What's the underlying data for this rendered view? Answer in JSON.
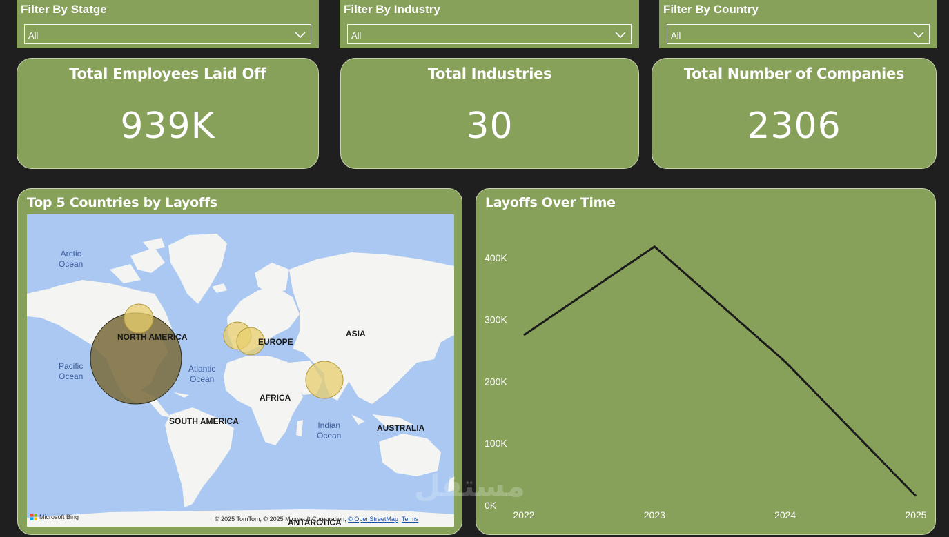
{
  "filters": [
    {
      "title": "Filter By Statge",
      "value": "All"
    },
    {
      "title": "Filter By Industry",
      "value": "All"
    },
    {
      "title": "Filter By Country",
      "value": "All"
    }
  ],
  "kpis": [
    {
      "title": "Total Employees Laid Off",
      "value": "939K"
    },
    {
      "title": "Total Industries",
      "value": "30"
    },
    {
      "title": "Total Number of Companies",
      "value": "2306"
    }
  ],
  "map": {
    "title": "Top 5 Countries by Layoffs",
    "labels": {
      "arctic": [
        "Arctic",
        "Ocean"
      ],
      "pacific": [
        "Pacific",
        "Ocean"
      ],
      "atlantic": [
        "Atlantic",
        "Ocean"
      ],
      "indian": [
        "Indian",
        "Ocean"
      ],
      "north_america": "NORTH AMERICA",
      "south_america": "SOUTH AMERICA",
      "europe": "EUROPE",
      "africa": "AFRICA",
      "asia": "ASIA",
      "australia": "AUSTRALIA",
      "antarctica": "ANTARCTICA"
    },
    "attribution": {
      "text": "© 2025 TomTom, © 2025 Microsoft Corporation, ",
      "osm": "© OpenStreetMap",
      "terms": "Terms"
    },
    "bing_label": "Microsoft Bing",
    "bubble_color": "#e8cf6c",
    "large_bubble_color": "#7a6a3a"
  },
  "chart_data": {
    "type": "line",
    "title": "Layoffs Over Time",
    "x": [
      "2022",
      "2023",
      "2024",
      "2025"
    ],
    "series": [
      {
        "values": [
          275000,
          418000,
          232000,
          15000
        ]
      }
    ],
    "ylim": [
      0,
      450000
    ],
    "yticks": [
      0,
      100000,
      200000,
      300000,
      400000
    ],
    "ytick_labels": [
      "0K",
      "100K",
      "200K",
      "300K",
      "400K"
    ],
    "grid": false,
    "line_color": "#1b1b1b"
  },
  "watermark": "مستقل"
}
